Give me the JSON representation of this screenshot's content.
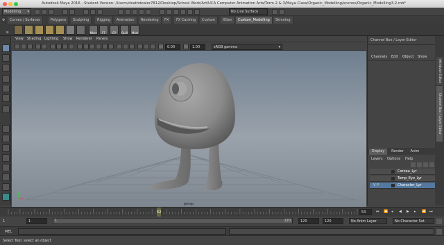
{
  "window": {
    "title": "Autodesk Maya 2016 - Student Version: /Users/deathdealer7812/Desktop/School Work/Art/UCA Computer Animation Arts/Term 2 & 3/Maya Class/Organic_Modelling/scenes/Organic_Modelling3.2.mb*"
  },
  "status": {
    "menuset": "Modelling",
    "live_surface": "No Live Surface"
  },
  "shelf": {
    "tabs": [
      "Curves / Surfaces",
      "Polygons",
      "Sculpting",
      "Rigging",
      "Animation",
      "Rendering",
      "FX",
      "FX Caching",
      "Custom",
      "XGen",
      "Custom_Modelling",
      "Skinning"
    ],
    "active_tab": "Custom_Modelling",
    "buttons": [
      "",
      "",
      "",
      "",
      "",
      "",
      "",
      "Mbst",
      "FT",
      "CP",
      "Quill",
      "Mnrt"
    ]
  },
  "panel": {
    "menus": [
      "View",
      "Shading",
      "Lighting",
      "Show",
      "Renderer",
      "Panels"
    ],
    "field_a": "0.00",
    "field_b": "1.00",
    "colorspace": "sRGB gamma",
    "camera_label": "persp"
  },
  "channelbox": {
    "header": "Channel Box / Layer Editor",
    "menus": [
      "Channels",
      "Edit",
      "Object",
      "Show"
    ],
    "side_tabs": [
      "Attribute Editor",
      "Channel Box / Layer Editor"
    ]
  },
  "layers": {
    "tabs": [
      "Display",
      "Render",
      "Anim"
    ],
    "menus": [
      "Layers",
      "Options",
      "Help"
    ],
    "rows": [
      {
        "name": "Cornea_Lyr",
        "flags": "",
        "selected": false
      },
      {
        "name": "Temp_Eye_Lyr",
        "flags": "",
        "selected": false
      },
      {
        "name": "Character_Lyr",
        "flags": "V P",
        "selected": true
      }
    ]
  },
  "timeline": {
    "ticks": [
      "1",
      "5",
      "10",
      "15",
      "20",
      "25",
      "30",
      "35",
      "40",
      "45",
      "50",
      "55",
      "60",
      "65",
      "70",
      "75",
      "80",
      "85",
      "90",
      "95",
      "100",
      "105",
      "110",
      "115",
      "120"
    ],
    "current_frame": "52",
    "end_field": "53"
  },
  "range": {
    "start": "1",
    "start2": "1",
    "range_start": "1",
    "range_end": "120",
    "end": "120",
    "end2": "120",
    "anim_layer": "No Anim Layer",
    "char_set": "No Character Set"
  },
  "mel": {
    "label": "MEL"
  },
  "help": {
    "text": "Select Tool: select an object"
  },
  "colors": {
    "accent": "#5479a0",
    "active_tab": "#5d5d5d",
    "viewport_top": "#6f7f90",
    "viewport_bottom": "#7e8790"
  }
}
